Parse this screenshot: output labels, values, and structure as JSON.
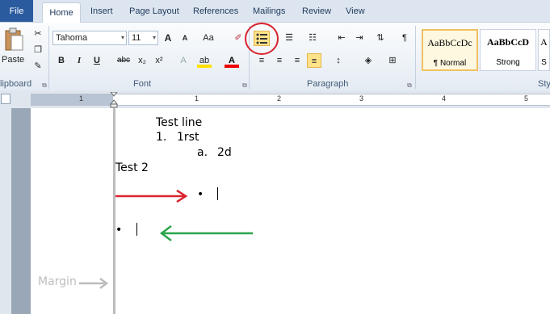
{
  "tabs": {
    "file": "File",
    "items": [
      "Home",
      "Insert",
      "Page Layout",
      "References",
      "Mailings",
      "Review",
      "View"
    ]
  },
  "font": {
    "name": "Tahoma",
    "size": "11",
    "group_label": "Font",
    "bold": "B",
    "italic": "I",
    "underline": "U",
    "strike": "abc",
    "sub": "x₂",
    "sup": "x²",
    "grow": "A",
    "shrink": "A",
    "case": "Aa",
    "color_letter": "A"
  },
  "clipboard": {
    "paste_label": "Paste",
    "group_label": "lipboard"
  },
  "paragraph": {
    "group_label": "Paragraph",
    "pilcrow": "¶"
  },
  "styles": {
    "items": [
      {
        "sample": "AaBbCcDc",
        "name": "¶ Normal"
      },
      {
        "sample": "AaBbCcD",
        "name": "Strong"
      },
      {
        "sample": "A",
        "name": "S"
      }
    ],
    "group_label": "Sty"
  },
  "ruler": {
    "numbers": [
      "1",
      "1",
      "2",
      "3",
      "4",
      "5"
    ]
  },
  "document": {
    "line1": "Test  line",
    "item1_num": "1.",
    "item1_text": "1rst",
    "sub_num": "a.",
    "sub_text": "2d",
    "line4": "Test 2",
    "bullet": "•",
    "margin_label": "Margin"
  },
  "annotations": {
    "red": "#d9232e",
    "green": "#2aa54a",
    "gray": "#bdbdbd"
  }
}
